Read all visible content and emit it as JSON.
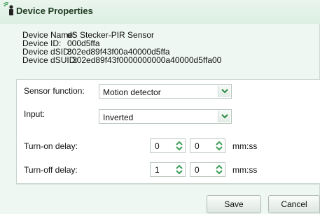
{
  "window": {
    "title": "Device Properties",
    "icon": "device-settings-icon"
  },
  "device_info": [
    {
      "label": "Device Name:",
      "value": "dS Stecker-PIR Sensor"
    },
    {
      "label": "Device ID:",
      "value": "000d5ffa"
    },
    {
      "label": "Device dSID:",
      "value": "302ed89f43f00a40000d5ffa"
    },
    {
      "label": "Device dSUID:",
      "value": "302ed89f43f0000000000a40000d5ffa00"
    }
  ],
  "form": {
    "sensor_function": {
      "label": "Sensor function:",
      "value": "Motion detector"
    },
    "input": {
      "label": "Input:",
      "value": "Inverted"
    },
    "turn_on_delay": {
      "label": "Turn-on delay:",
      "minutes": "0",
      "seconds": "0",
      "unit": "mm:ss"
    },
    "turn_off_delay": {
      "label": "Turn-off delay:",
      "minutes": "1",
      "seconds": "0",
      "unit": "mm:ss"
    }
  },
  "buttons": {
    "save": "Save",
    "cancel": "Cancel"
  },
  "colors": {
    "accent": "#2e8b45",
    "title_text": "#1e3a1f",
    "spinner": "#3a9d55"
  }
}
